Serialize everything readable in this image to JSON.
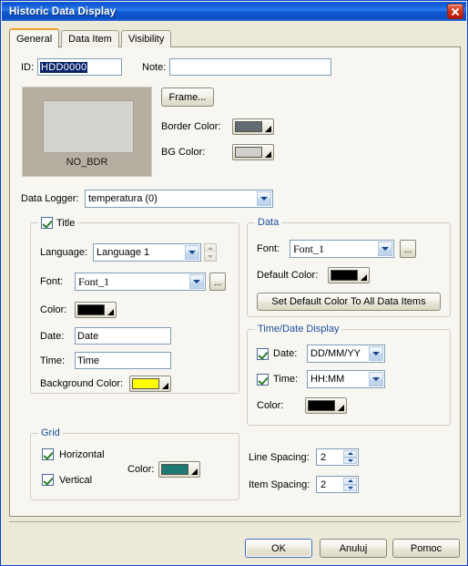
{
  "window": {
    "title": "Historic Data Display",
    "close_icon": "close-icon"
  },
  "tabs": [
    {
      "label": "General",
      "active": true
    },
    {
      "label": "Data Item",
      "active": false
    },
    {
      "label": "Visibility",
      "active": false
    }
  ],
  "general": {
    "id_label": "ID:",
    "id_value": "HDD0000",
    "note_label": "Note:",
    "note_value": "",
    "preview": {
      "caption": "NO_BDR",
      "outer_color": "#b5aea1",
      "inner_color": "#d4d2cd"
    },
    "frame_button": "Frame...",
    "border_color_label": "Border Color:",
    "border_color_value": "#626a72",
    "bg_color_label": "BG Color:",
    "bg_color_value": "#d0cfcb",
    "data_logger_label": "Data Logger:",
    "data_logger_value": "temperatura (0)"
  },
  "title_group": {
    "caption": "Title",
    "checked": true,
    "language_label": "Language:",
    "language_value": "Language 1",
    "font_label": "Font:",
    "font_value": "Font_1",
    "browse_label": "...",
    "color_label": "Color:",
    "color_value": "#000000",
    "date_label": "Date:",
    "date_value": "Date",
    "time_label": "Time:",
    "time_value": "Time",
    "background_color_label": "Background Color:",
    "background_color_value": "#ffff00"
  },
  "data_group": {
    "caption": "Data",
    "font_label": "Font:",
    "font_value": "Font_1",
    "browse_label": "...",
    "default_color_label": "Default Color:",
    "default_color_value": "#000000",
    "set_default_button": "Set Default Color To All Data Items"
  },
  "time_date_group": {
    "caption": "Time/Date Display",
    "date_checked": true,
    "date_label": "Date:",
    "date_format": "DD/MM/YY",
    "time_checked": true,
    "time_label": "Time:",
    "time_format": "HH:MM",
    "color_label": "Color:",
    "color_value": "#000000"
  },
  "grid_group": {
    "caption": "Grid",
    "horizontal_label": "Horizontal",
    "horizontal_checked": true,
    "vertical_label": "Vertical",
    "vertical_checked": true,
    "color_label": "Color:",
    "color_value": "#1c7a72"
  },
  "spacing": {
    "line_spacing_label": "Line Spacing:",
    "line_spacing_value": "2",
    "item_spacing_label": "Item Spacing:",
    "item_spacing_value": "2"
  },
  "footer": {
    "ok": "OK",
    "cancel": "Anuluj",
    "help": "Pomoc"
  }
}
